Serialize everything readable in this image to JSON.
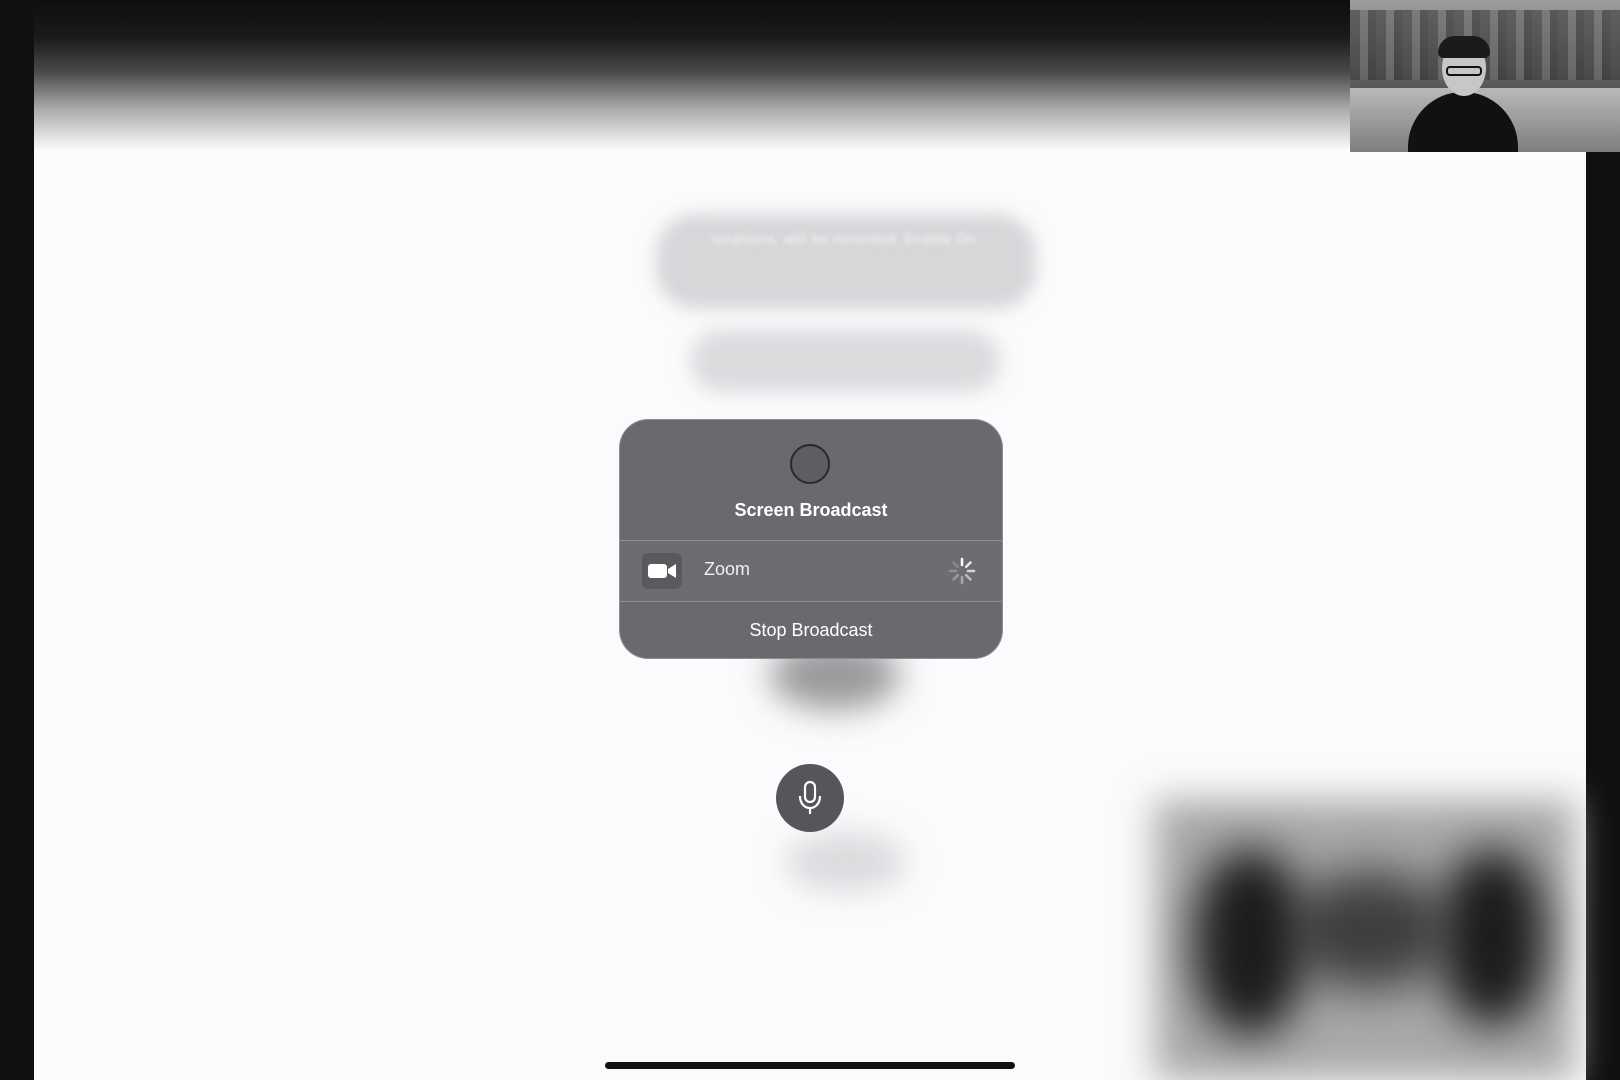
{
  "blurred_background": {
    "text_fragment": "locations, will be recorded. Enable On"
  },
  "screen_broadcast": {
    "title": "Screen Broadcast",
    "app_name": "Zoom",
    "stop_button_label": "Stop Broadcast"
  },
  "icons": {
    "record": "record-icon",
    "video": "video-camera-icon",
    "loading": "loading-spinner-icon",
    "mic": "microphone-icon"
  }
}
